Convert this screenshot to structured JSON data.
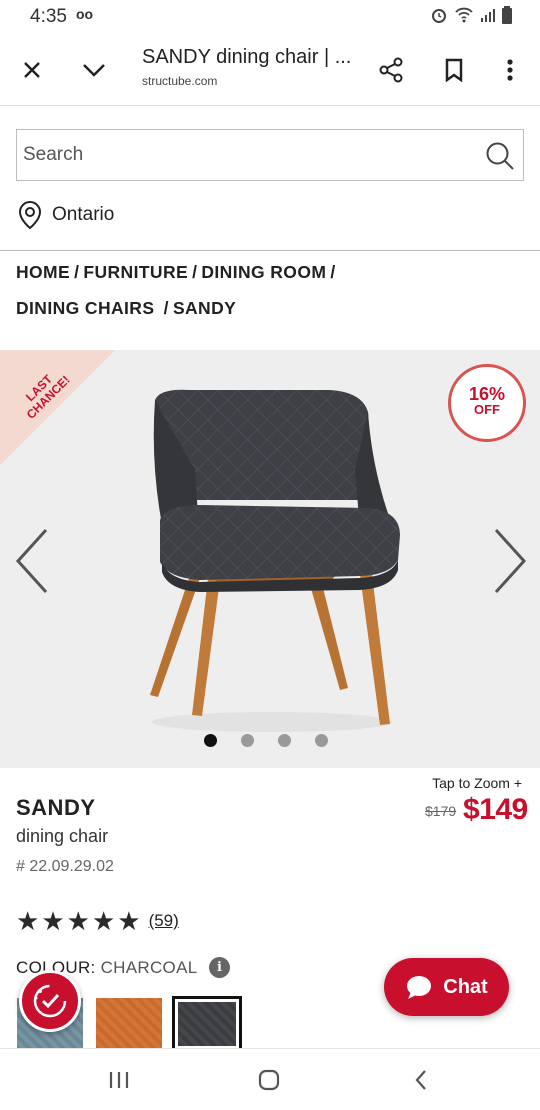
{
  "status": {
    "time": "4:35",
    "voicemail": "oo"
  },
  "browser": {
    "title": "SANDY dining chair | ...",
    "url": "structube.com"
  },
  "search": {
    "placeholder": "Search"
  },
  "location": {
    "label": "Ontario"
  },
  "breadcrumb": {
    "items": [
      "HOME",
      "FURNITURE",
      "DINING ROOM",
      "DINING CHAIRS",
      "SANDY"
    ],
    "separator": "/"
  },
  "gallery": {
    "ribbon": "LAST CHANCE!",
    "discount_pct": "16%",
    "discount_off": "OFF",
    "image_count": 4,
    "active_index": 0
  },
  "product": {
    "tap_to_zoom": "Tap to Zoom +",
    "name": "SANDY",
    "subtitle": "dining chair",
    "sku": "# 22.09.29.02",
    "price_old": "$179",
    "price_new": "$149",
    "rating": 5,
    "review_count": "(59)",
    "colour_label": "COLOUR:",
    "colour_value": "CHARCOAL",
    "swatches": [
      "blue",
      "orange",
      "charcoal"
    ],
    "selected_swatch": "charcoal"
  },
  "chat": {
    "label": "Chat"
  },
  "colors": {
    "brand_red": "#c8102e",
    "ribbon_bg": "#f3d9cf",
    "image_bg": "#eeeeee"
  }
}
